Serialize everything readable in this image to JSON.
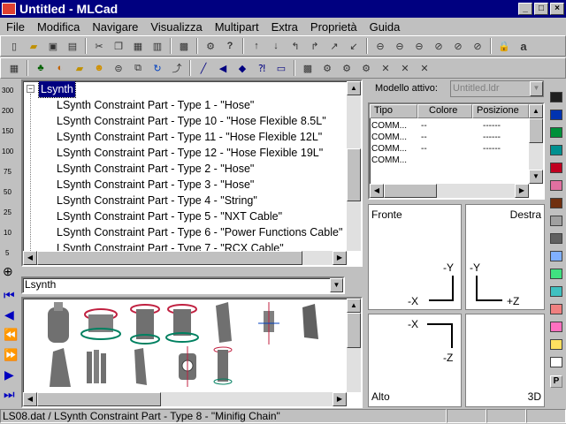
{
  "window": {
    "title": "Untitled - MLCad"
  },
  "menu": [
    "File",
    "Modifica",
    "Navigare",
    "Visualizza",
    "Multipart",
    "Extra",
    "Proprietà",
    "Guida"
  ],
  "tree": {
    "root": "Lsynth",
    "items": [
      "LSynth Constraint Part - Type 1 - \"Hose\"",
      "LSynth Constraint Part - Type 10 - \"Hose Flexible 8.5L\"",
      "LSynth Constraint Part - Type 11 - \"Hose Flexible 12L\"",
      "LSynth Constraint Part - Type 12 - \"Hose Flexible 19L\"",
      "LSynth Constraint Part - Type 2 - \"Hose\"",
      "LSynth Constraint Part - Type 3 - \"Hose\"",
      "LSynth Constraint Part - Type 4 - \"String\"",
      "LSynth Constraint Part - Type 5 - \"NXT Cable\"",
      "LSynth Constraint Part - Type 6 - \"Power Functions Cable\"",
      "LSynth Constraint Part - Type 7 - \"RCX Cable\""
    ]
  },
  "zoom_levels": [
    "300",
    "200",
    "150",
    "100",
    "75",
    "50",
    "25",
    "10",
    "5"
  ],
  "parts_combo": {
    "value": "Lsynth"
  },
  "model": {
    "label": "Modello attivo:",
    "value": "Untitled.ldr",
    "columns": [
      "Tipo",
      "Colore",
      "Posizione"
    ],
    "rows": [
      {
        "tipo": "COMM...",
        "colore": "--",
        "posizione": "------"
      },
      {
        "tipo": "COMM...",
        "colore": "--",
        "posizione": "------"
      },
      {
        "tipo": "COMM...",
        "colore": "--",
        "posizione": "------"
      },
      {
        "tipo": "COMM...",
        "colore": "--",
        "posizione": "------"
      }
    ]
  },
  "views": {
    "front": {
      "name": "Fronte",
      "axis_v": "-Y",
      "axis_h": "-X"
    },
    "right": {
      "name": "Destra",
      "axis_v": "-Y",
      "axis_h": "+Z"
    },
    "top": {
      "name": "Alto",
      "axis_v": "-X",
      "axis_h": "-Z"
    },
    "perspective": {
      "name": "3D"
    }
  },
  "palette": [
    "#202020",
    "#0033b0",
    "#00903a",
    "#009090",
    "#c00020",
    "#e070a0",
    "#703010",
    "#a0a0a0",
    "#606060",
    "#80b0ff",
    "#40e080",
    "#40c0c0",
    "#f08080",
    "#ff70c0",
    "#ffe060",
    "#ffffff"
  ],
  "palette_more": "P",
  "toolbar_right_label": "a",
  "status": {
    "text": "LS08.dat / LSynth Constraint Part - Type 8 - \"Minifig Chain\""
  }
}
